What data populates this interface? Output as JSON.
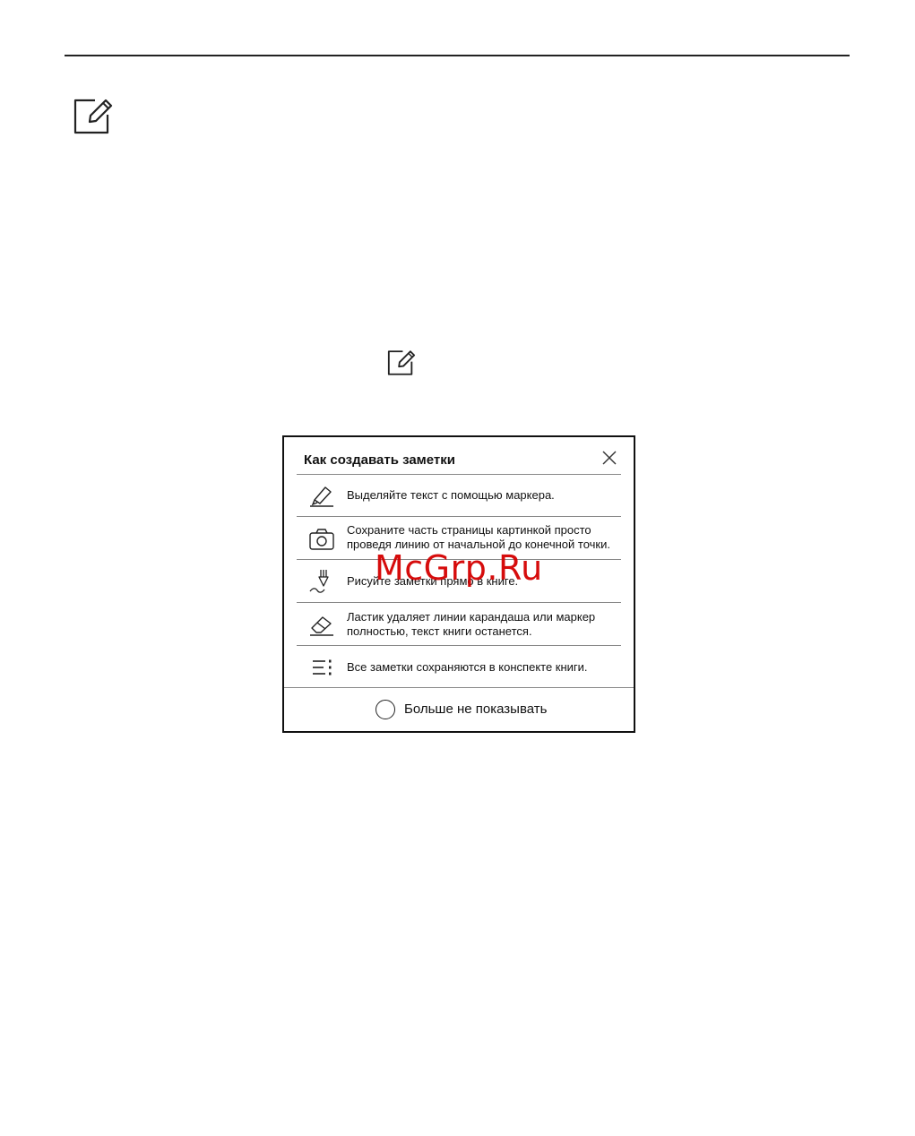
{
  "icons": {
    "page_note": "note-edit-icon",
    "inline_note": "note-edit-icon"
  },
  "dialog": {
    "title": "Как создавать заметки",
    "close_icon": "close-icon",
    "rows": [
      {
        "icon": "marker-icon",
        "text": "Выделяйте текст с помощью маркера."
      },
      {
        "icon": "camera-icon",
        "text": "Сохраните часть страницы картинкой просто проведя линию от начальной до конечной точки."
      },
      {
        "icon": "pen-icon",
        "text": "Рисуйте заметки прямо в книге."
      },
      {
        "icon": "eraser-icon",
        "text": "Ластик удаляет линии карандаша или маркер полностью, текст книги останется."
      },
      {
        "icon": "list-icon",
        "text": "Все заметки сохраняются в конспекте книги."
      }
    ],
    "footer_label": "Больше не показывать"
  },
  "watermark": "McGrp.Ru"
}
